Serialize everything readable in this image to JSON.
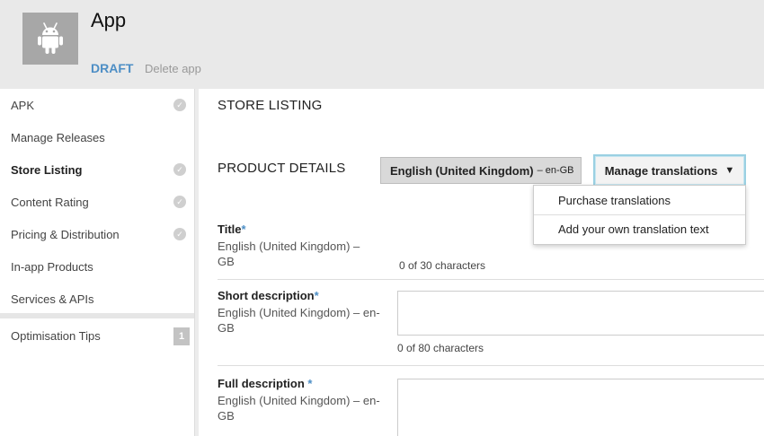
{
  "header": {
    "app_title": "App",
    "status": "DRAFT",
    "delete_label": "Delete app",
    "app_icon": "android-icon"
  },
  "sidebar": {
    "items": [
      {
        "label": "APK",
        "complete": true
      },
      {
        "label": "Manage Releases",
        "complete": false
      },
      {
        "label": "Store Listing",
        "complete": true,
        "active": true
      },
      {
        "label": "Content Rating",
        "complete": true
      },
      {
        "label": "Pricing & Distribution",
        "complete": true
      },
      {
        "label": "In-app Products",
        "complete": false
      },
      {
        "label": "Services & APIs",
        "complete": false
      }
    ],
    "tips": {
      "label": "Optimisation Tips",
      "count": "1"
    }
  },
  "main": {
    "page_title": "STORE LISTING",
    "section_title": "PRODUCT DETAILS",
    "language": {
      "name": "English (United Kingdom)",
      "separator": "–",
      "code": "en-GB"
    },
    "manage_translations": {
      "label": "Manage translations",
      "caret": "▼"
    },
    "dropdown": {
      "items": [
        {
          "label": "Purchase translations"
        },
        {
          "label": "Add your own translation text"
        }
      ]
    },
    "fields": {
      "title": {
        "label": "Title",
        "required": "*",
        "language": "English (United Kingdom) – GB",
        "count": "0 of 30 characters"
      },
      "short_description": {
        "label": "Short description",
        "required": "*",
        "language": "English (United Kingdom) – en-GB",
        "count": "0 of 80 characters"
      },
      "full_description": {
        "label": "Full description ",
        "required": "*",
        "language": "English (United Kingdom) – en-GB"
      }
    }
  },
  "colors": {
    "accent": "#4d8ec5",
    "header_bg": "#e9e9e9",
    "icon_bg": "#a7a7a7",
    "focus_ring": "#9ad0e2"
  }
}
